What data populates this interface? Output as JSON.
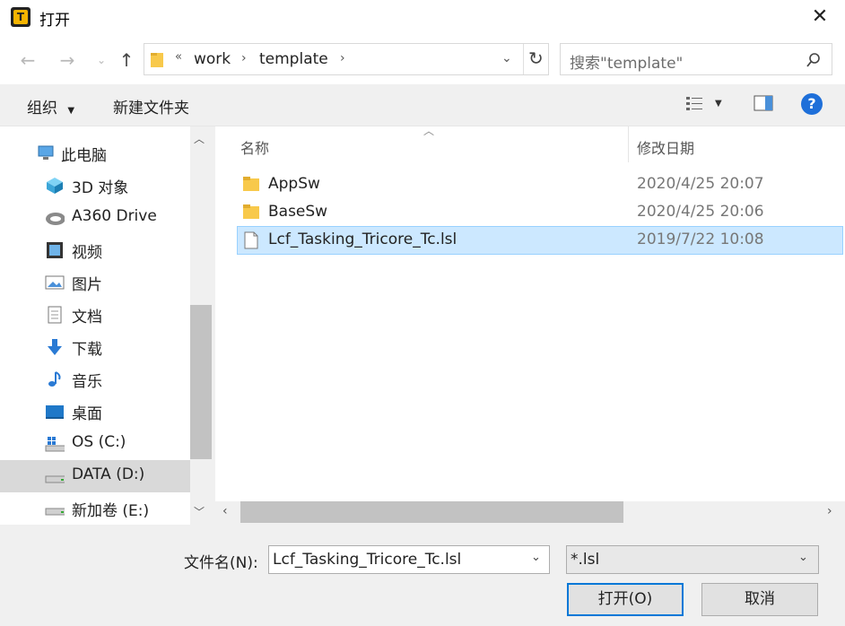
{
  "window": {
    "title": "打开",
    "close_icon": "close-icon"
  },
  "nav": {
    "back_icon": "arrow-left-icon",
    "forward_icon": "arrow-right-icon",
    "recent_icon": "chevron-down-icon",
    "up_icon": "arrow-up-icon",
    "breadcrumb": {
      "prefix": "«",
      "items": [
        "work",
        "template"
      ]
    },
    "refresh_icon": "refresh-icon",
    "search_placeholder": "搜索\"template\""
  },
  "toolbar": {
    "organize": "组织",
    "new_folder": "新建文件夹"
  },
  "sidebar": {
    "items": [
      {
        "label": "此电脑",
        "icon": "computer-icon"
      },
      {
        "label": "3D 对象",
        "icon": "cube-icon"
      },
      {
        "label": "A360 Drive",
        "icon": "cloud-drive-icon"
      },
      {
        "label": "视频",
        "icon": "video-icon"
      },
      {
        "label": "图片",
        "icon": "picture-icon"
      },
      {
        "label": "文档",
        "icon": "document-icon"
      },
      {
        "label": "下载",
        "icon": "download-icon"
      },
      {
        "label": "音乐",
        "icon": "music-icon"
      },
      {
        "label": "桌面",
        "icon": "desktop-icon"
      },
      {
        "label": "OS (C:)",
        "icon": "os-drive-icon"
      },
      {
        "label": "DATA (D:)",
        "icon": "drive-icon"
      },
      {
        "label": "新加卷 (E:)",
        "icon": "drive-icon"
      }
    ],
    "selected": "DATA (D:)"
  },
  "file_list": {
    "columns": [
      "名称",
      "修改日期"
    ],
    "rows": [
      {
        "name": "AppSw",
        "date": "2020/4/25 20:07",
        "icon": "folder-icon"
      },
      {
        "name": "BaseSw",
        "date": "2020/4/25 20:06",
        "icon": "folder-icon"
      },
      {
        "name": "Lcf_Tasking_Tricore_Tc.lsl",
        "date": "2019/7/22 10:08",
        "icon": "file-icon",
        "selected": true
      }
    ]
  },
  "bottom": {
    "filename_label": "文件名(N):",
    "filename_value": "Lcf_Tasking_Tricore_Tc.lsl",
    "filter_value": "*.lsl",
    "open_button": "打开(O)",
    "cancel_button": "取消"
  },
  "colors": {
    "selection": "#cce8ff",
    "accent": "#0078d7",
    "help": "#1e6fd9"
  }
}
